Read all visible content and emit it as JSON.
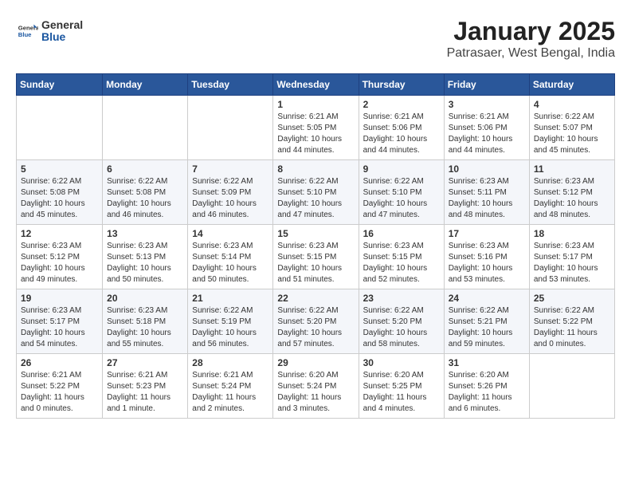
{
  "header": {
    "logo_general": "General",
    "logo_blue": "Blue",
    "title": "January 2025",
    "subtitle": "Patrasaer, West Bengal, India"
  },
  "days_header": [
    "Sunday",
    "Monday",
    "Tuesday",
    "Wednesday",
    "Thursday",
    "Friday",
    "Saturday"
  ],
  "weeks": [
    [
      {
        "num": "",
        "info": ""
      },
      {
        "num": "",
        "info": ""
      },
      {
        "num": "",
        "info": ""
      },
      {
        "num": "1",
        "info": "Sunrise: 6:21 AM\nSunset: 5:05 PM\nDaylight: 10 hours\nand 44 minutes."
      },
      {
        "num": "2",
        "info": "Sunrise: 6:21 AM\nSunset: 5:06 PM\nDaylight: 10 hours\nand 44 minutes."
      },
      {
        "num": "3",
        "info": "Sunrise: 6:21 AM\nSunset: 5:06 PM\nDaylight: 10 hours\nand 44 minutes."
      },
      {
        "num": "4",
        "info": "Sunrise: 6:22 AM\nSunset: 5:07 PM\nDaylight: 10 hours\nand 45 minutes."
      }
    ],
    [
      {
        "num": "5",
        "info": "Sunrise: 6:22 AM\nSunset: 5:08 PM\nDaylight: 10 hours\nand 45 minutes."
      },
      {
        "num": "6",
        "info": "Sunrise: 6:22 AM\nSunset: 5:08 PM\nDaylight: 10 hours\nand 46 minutes."
      },
      {
        "num": "7",
        "info": "Sunrise: 6:22 AM\nSunset: 5:09 PM\nDaylight: 10 hours\nand 46 minutes."
      },
      {
        "num": "8",
        "info": "Sunrise: 6:22 AM\nSunset: 5:10 PM\nDaylight: 10 hours\nand 47 minutes."
      },
      {
        "num": "9",
        "info": "Sunrise: 6:22 AM\nSunset: 5:10 PM\nDaylight: 10 hours\nand 47 minutes."
      },
      {
        "num": "10",
        "info": "Sunrise: 6:23 AM\nSunset: 5:11 PM\nDaylight: 10 hours\nand 48 minutes."
      },
      {
        "num": "11",
        "info": "Sunrise: 6:23 AM\nSunset: 5:12 PM\nDaylight: 10 hours\nand 48 minutes."
      }
    ],
    [
      {
        "num": "12",
        "info": "Sunrise: 6:23 AM\nSunset: 5:12 PM\nDaylight: 10 hours\nand 49 minutes."
      },
      {
        "num": "13",
        "info": "Sunrise: 6:23 AM\nSunset: 5:13 PM\nDaylight: 10 hours\nand 50 minutes."
      },
      {
        "num": "14",
        "info": "Sunrise: 6:23 AM\nSunset: 5:14 PM\nDaylight: 10 hours\nand 50 minutes."
      },
      {
        "num": "15",
        "info": "Sunrise: 6:23 AM\nSunset: 5:15 PM\nDaylight: 10 hours\nand 51 minutes."
      },
      {
        "num": "16",
        "info": "Sunrise: 6:23 AM\nSunset: 5:15 PM\nDaylight: 10 hours\nand 52 minutes."
      },
      {
        "num": "17",
        "info": "Sunrise: 6:23 AM\nSunset: 5:16 PM\nDaylight: 10 hours\nand 53 minutes."
      },
      {
        "num": "18",
        "info": "Sunrise: 6:23 AM\nSunset: 5:17 PM\nDaylight: 10 hours\nand 53 minutes."
      }
    ],
    [
      {
        "num": "19",
        "info": "Sunrise: 6:23 AM\nSunset: 5:17 PM\nDaylight: 10 hours\nand 54 minutes."
      },
      {
        "num": "20",
        "info": "Sunrise: 6:23 AM\nSunset: 5:18 PM\nDaylight: 10 hours\nand 55 minutes."
      },
      {
        "num": "21",
        "info": "Sunrise: 6:22 AM\nSunset: 5:19 PM\nDaylight: 10 hours\nand 56 minutes."
      },
      {
        "num": "22",
        "info": "Sunrise: 6:22 AM\nSunset: 5:20 PM\nDaylight: 10 hours\nand 57 minutes."
      },
      {
        "num": "23",
        "info": "Sunrise: 6:22 AM\nSunset: 5:20 PM\nDaylight: 10 hours\nand 58 minutes."
      },
      {
        "num": "24",
        "info": "Sunrise: 6:22 AM\nSunset: 5:21 PM\nDaylight: 10 hours\nand 59 minutes."
      },
      {
        "num": "25",
        "info": "Sunrise: 6:22 AM\nSunset: 5:22 PM\nDaylight: 11 hours\nand 0 minutes."
      }
    ],
    [
      {
        "num": "26",
        "info": "Sunrise: 6:21 AM\nSunset: 5:22 PM\nDaylight: 11 hours\nand 0 minutes."
      },
      {
        "num": "27",
        "info": "Sunrise: 6:21 AM\nSunset: 5:23 PM\nDaylight: 11 hours\nand 1 minute."
      },
      {
        "num": "28",
        "info": "Sunrise: 6:21 AM\nSunset: 5:24 PM\nDaylight: 11 hours\nand 2 minutes."
      },
      {
        "num": "29",
        "info": "Sunrise: 6:20 AM\nSunset: 5:24 PM\nDaylight: 11 hours\nand 3 minutes."
      },
      {
        "num": "30",
        "info": "Sunrise: 6:20 AM\nSunset: 5:25 PM\nDaylight: 11 hours\nand 4 minutes."
      },
      {
        "num": "31",
        "info": "Sunrise: 6:20 AM\nSunset: 5:26 PM\nDaylight: 11 hours\nand 6 minutes."
      },
      {
        "num": "",
        "info": ""
      }
    ]
  ]
}
